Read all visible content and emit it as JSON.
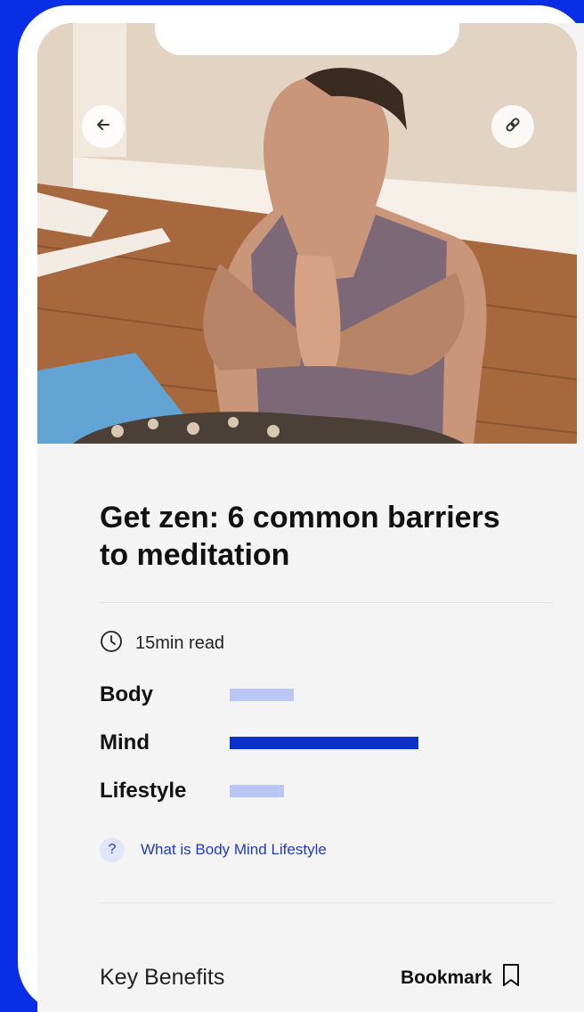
{
  "article": {
    "title": "Get zen: 6 common barriers to meditation",
    "read_time": "15min read"
  },
  "metrics": [
    {
      "label": "Body",
      "level": 0.27
    },
    {
      "label": "Mind",
      "level": 0.8
    },
    {
      "label": "Lifestyle",
      "level": 0.23
    }
  ],
  "help_link": "What is Body Mind Lifestyle",
  "footer": {
    "section_title": "Key Benefits",
    "bookmark_label": "Bookmark"
  },
  "icons": {
    "back": "arrow-left-icon",
    "share": "link-icon",
    "time": "clock-icon",
    "help": "question-icon",
    "bookmark": "bookmark-icon"
  },
  "colors": {
    "brand": "#0a2ee6",
    "bar_active": "#0a32c8",
    "bar_muted": "#bcc6f5",
    "link": "#1c3cc9"
  }
}
